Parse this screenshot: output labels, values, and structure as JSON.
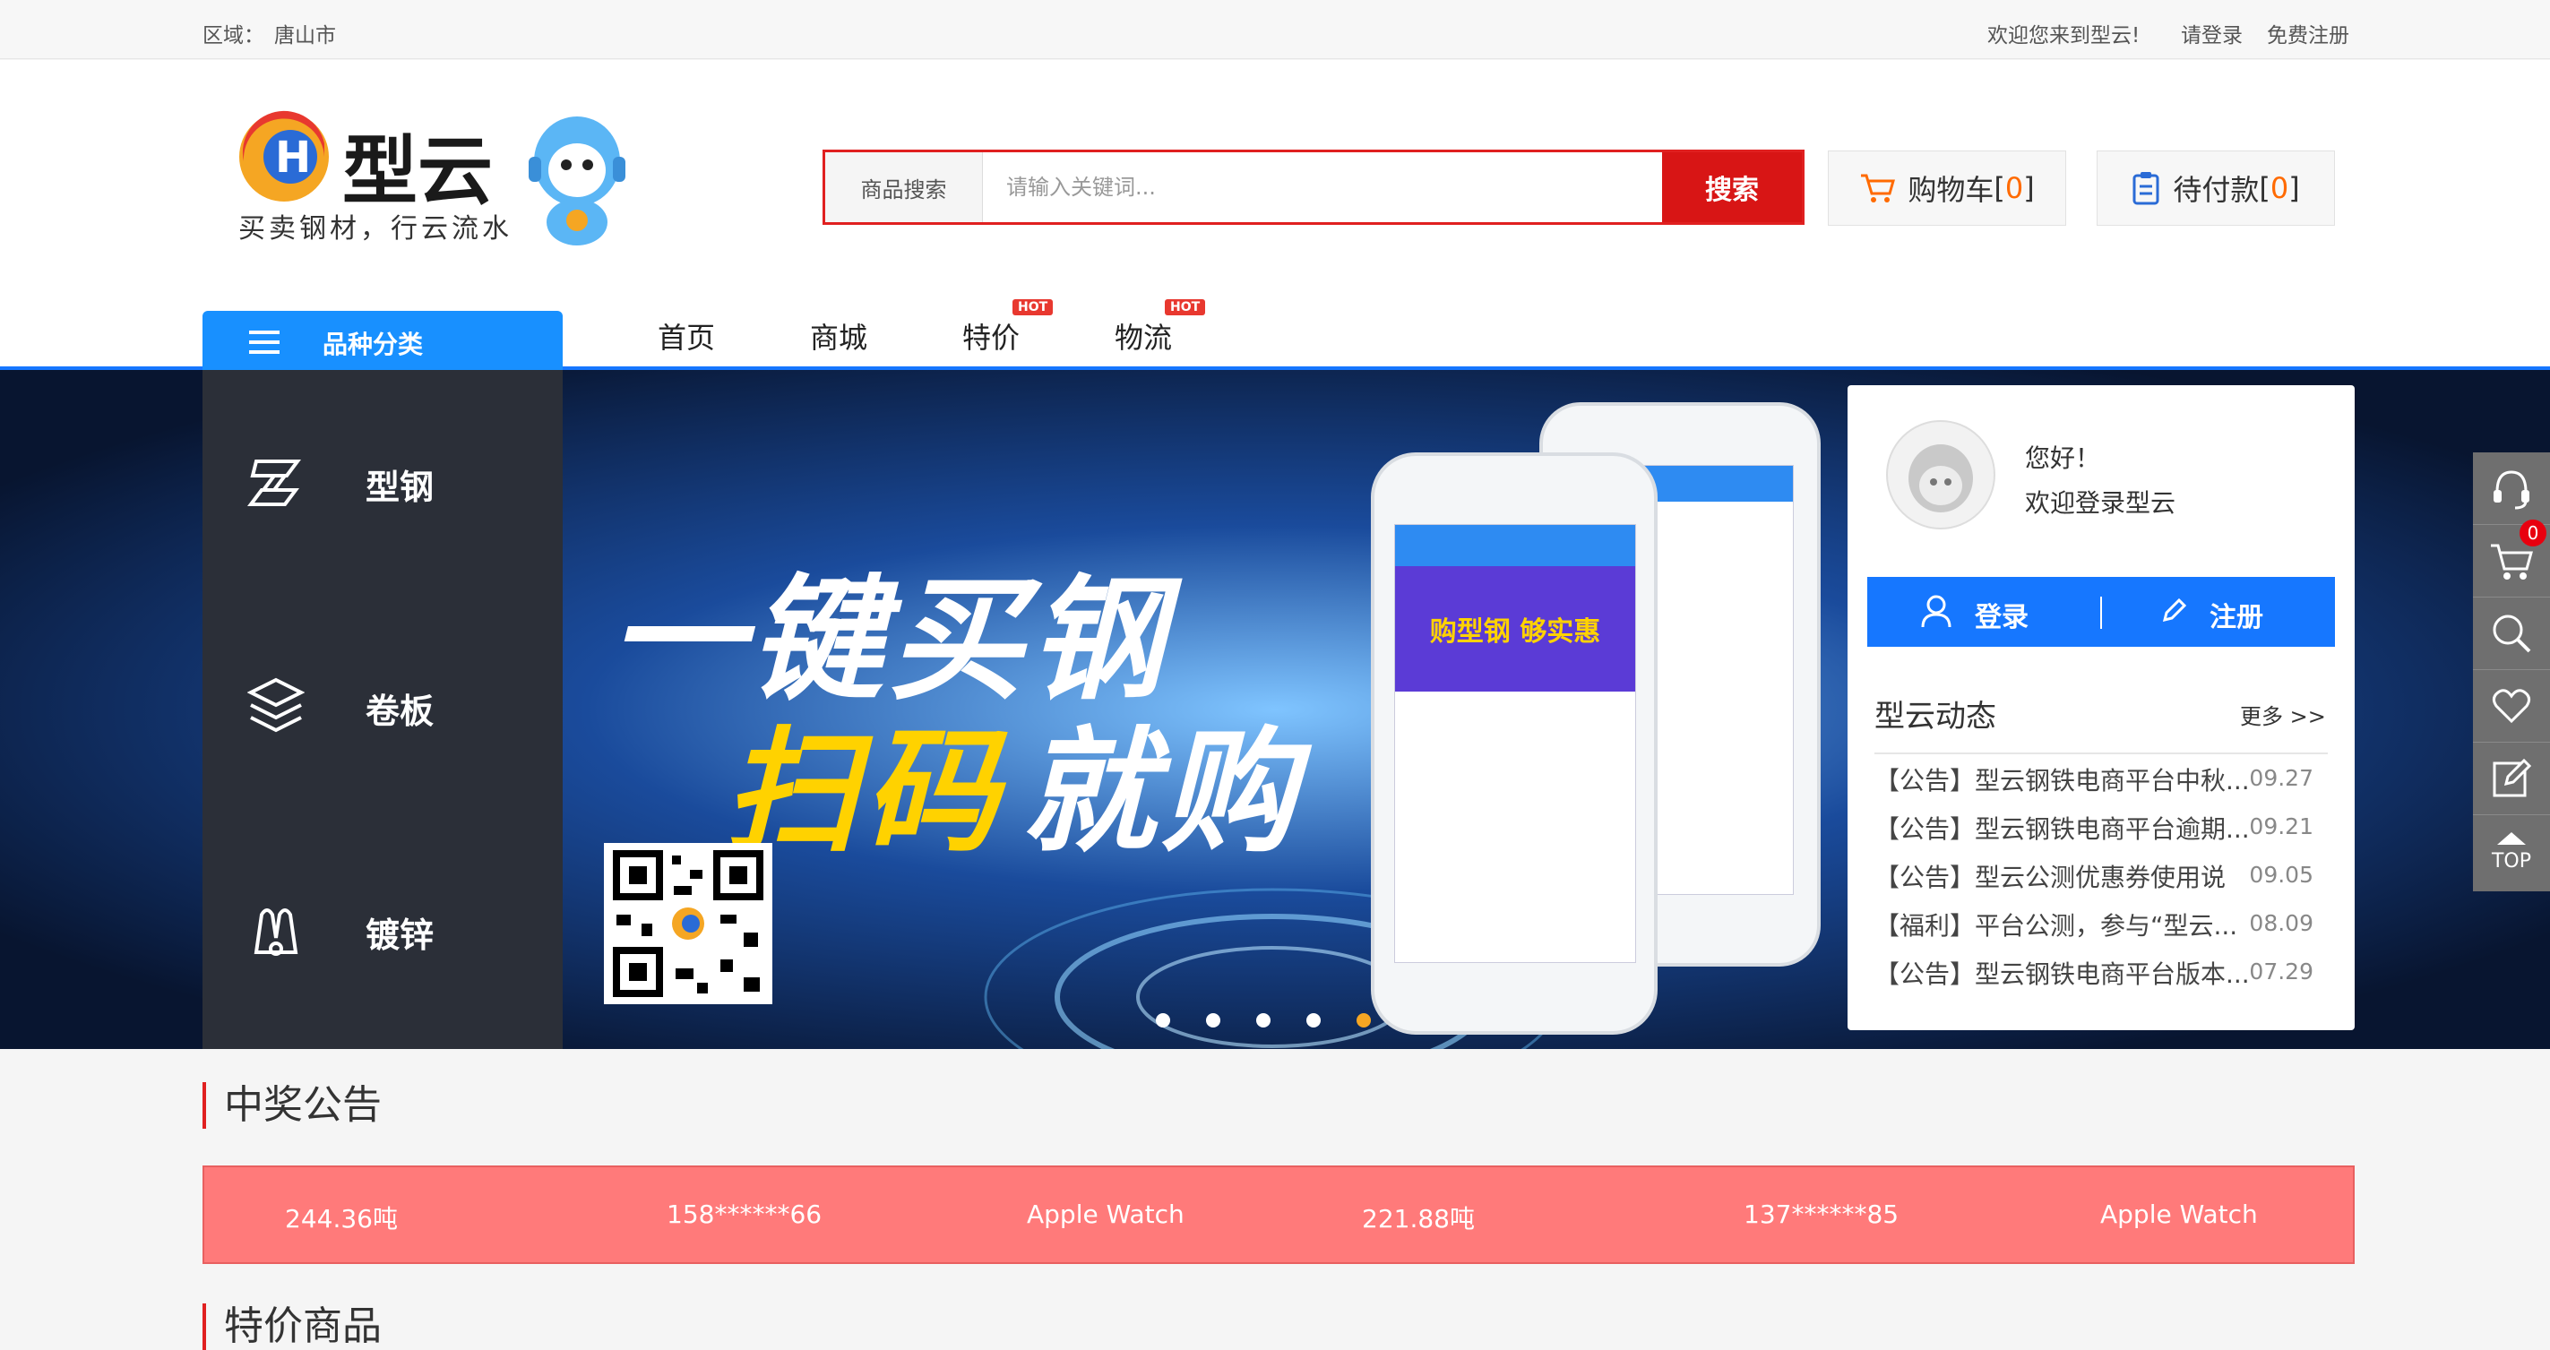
{
  "topbar": {
    "region_label": "区域：",
    "region_value": "唐山市",
    "welcome": "欢迎您来到型云!",
    "login_link": "请登录",
    "register_link": "免费注册"
  },
  "logo": {
    "name": "型云",
    "slogan": "买卖钢材，行云流水"
  },
  "search": {
    "category": "商品搜索",
    "placeholder": "请输入关键词...",
    "button": "搜索"
  },
  "cart": {
    "label": "购物车",
    "count_open": "[",
    "count": "0",
    "count_close": "]"
  },
  "pending": {
    "label": "待付款",
    "count_open": "[",
    "count": "0",
    "count_close": "]"
  },
  "category_menu": {
    "title": "品种分类",
    "items": [
      {
        "label": "型钢",
        "icon": "steel-beam-icon"
      },
      {
        "label": "卷板",
        "icon": "layers-icon"
      },
      {
        "label": "镀锌",
        "icon": "galvanized-icon"
      }
    ]
  },
  "nav": {
    "items": [
      {
        "label": "首页",
        "hot": ""
      },
      {
        "label": "商城",
        "hot": ""
      },
      {
        "label": "特价",
        "hot": "HOT"
      },
      {
        "label": "物流",
        "hot": "HOT"
      }
    ]
  },
  "banner": {
    "headline_1": "一键买钢",
    "headline_2_a": "扫码",
    "headline_2_b": "就购",
    "phone_text": "购型钢 够实惠",
    "dots": 5
  },
  "login_card": {
    "greeting": "您好！",
    "welcome": "欢迎登录型云",
    "login_button": "登录",
    "register_button": "注册",
    "news_title": "型云动态",
    "more": "更多 >>",
    "news": [
      {
        "text": "【公告】型云钢铁电商平台中秋...",
        "date": "09.27"
      },
      {
        "text": "【公告】型云钢铁电商平台逾期...",
        "date": "09.21"
      },
      {
        "text": "【公告】型云公测优惠券使用说",
        "date": "09.05"
      },
      {
        "text": "【福利】平台公测，参与“型云...",
        "date": "08.09"
      },
      {
        "text": "【公告】型云钢铁电商平台版本...",
        "date": "07.29"
      }
    ]
  },
  "side_tools": {
    "cart_badge": "0",
    "top_label": "TOP",
    "icons": [
      "headset-icon",
      "cart-icon",
      "search-icon",
      "heart-icon",
      "edit-icon",
      "arrow-up-icon"
    ]
  },
  "notice": {
    "title": "中奖公告",
    "items": [
      "244.36吨",
      "158******66",
      "Apple Watch",
      "221.88吨",
      "137******85",
      "Apple Watch"
    ]
  },
  "special": {
    "title": "特价商品"
  },
  "colors": {
    "brand_blue": "#1677ff",
    "search_red": "#d81515",
    "notice_bg": "#ff7a7a",
    "accent_orange": "#ff6a00"
  }
}
